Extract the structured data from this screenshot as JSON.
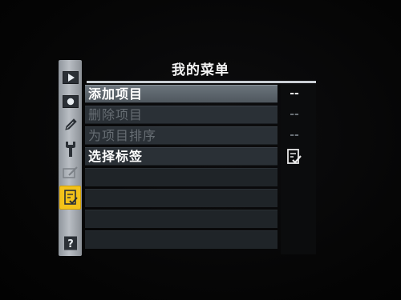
{
  "menu": {
    "title": "我的菜单",
    "items": [
      {
        "label": "添加项目",
        "value": "--",
        "enabled": true,
        "highlighted": true
      },
      {
        "label": "删除项目",
        "value": "--",
        "enabled": false,
        "highlighted": false
      },
      {
        "label": "为项目排序",
        "value": "--",
        "enabled": false,
        "highlighted": false
      },
      {
        "label": "选择标签",
        "value_icon": "my-menu-tab-icon",
        "enabled": true,
        "highlighted": false
      }
    ]
  },
  "sidebar": {
    "icons": [
      {
        "name": "playback-menu-icon"
      },
      {
        "name": "shooting-menu-icon"
      },
      {
        "name": "custom-settings-icon"
      },
      {
        "name": "setup-menu-icon"
      },
      {
        "name": "retouch-menu-icon"
      },
      {
        "name": "my-menu-icon",
        "active": true
      },
      {
        "name": "help-icon"
      }
    ]
  },
  "colors": {
    "active_tab": "#f3c21a",
    "highlight_row": "#5a636b",
    "row_bg": "#2a3036",
    "disabled_text": "#666d73"
  }
}
